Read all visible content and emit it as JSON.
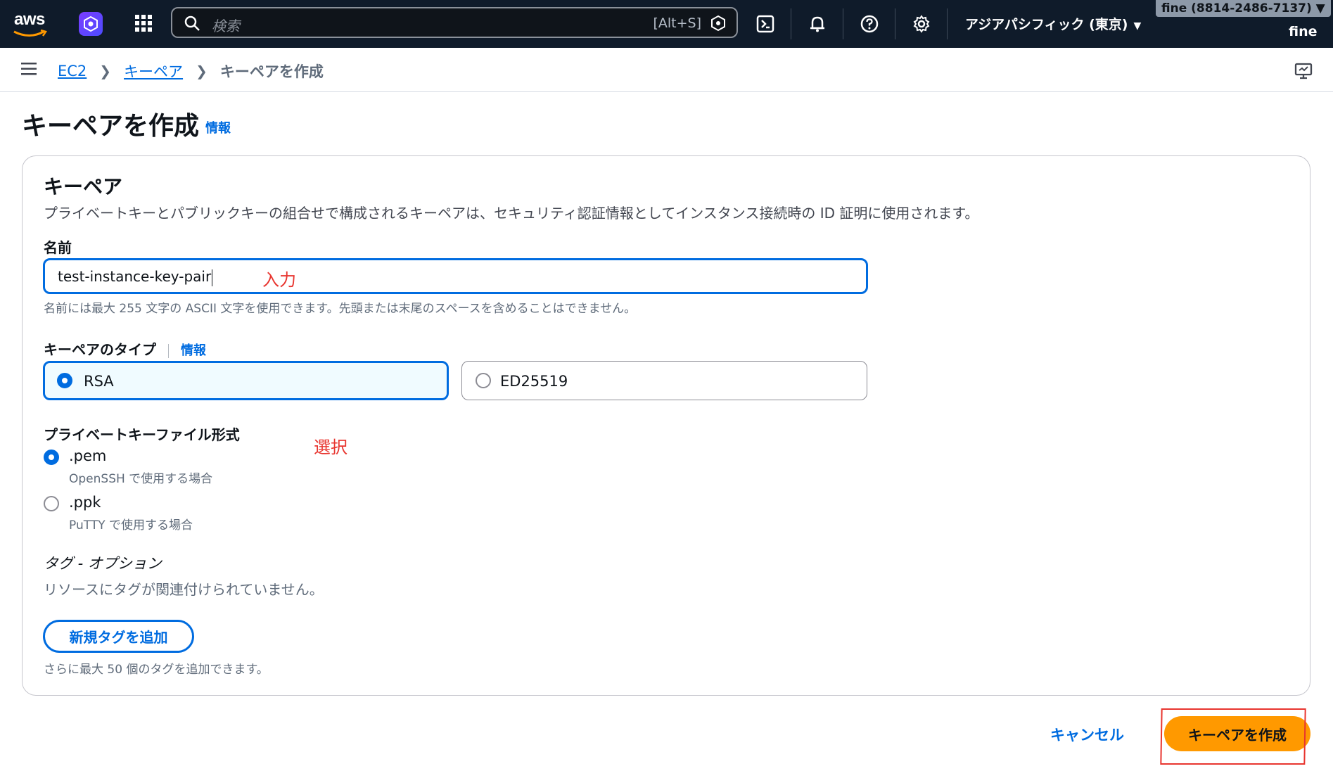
{
  "topnav": {
    "logo_text": "aws",
    "search_placeholder": "検索",
    "search_shortcut": "[Alt+S]",
    "region": "アジアパシフィック (東京)",
    "account_badge": "fine (8814-2486-7137) ▼",
    "account_name": "fine"
  },
  "breadcrumb": {
    "items": [
      "EC2",
      "キーペア"
    ],
    "current": "キーペアを作成"
  },
  "page": {
    "title": "キーペアを作成",
    "info": "情報"
  },
  "panel": {
    "heading": "キーペア",
    "description": "プライベートキーとパブリックキーの組合せで構成されるキーペアは、セキュリティ認証情報としてインスタンス接続時の ID 証明に使用されます。",
    "name": {
      "label": "名前",
      "value": "test-instance-key-pair",
      "hint": "名前には最大 255 文字の ASCII 文字を使用できます。先頭または末尾のスペースを含めることはできません。"
    },
    "key_type": {
      "label": "キーペアのタイプ",
      "info": "情報",
      "options": [
        "RSA",
        "ED25519"
      ],
      "selected": "RSA"
    },
    "file_format": {
      "label": "プライベートキーファイル形式",
      "options": [
        {
          "label": ".pem",
          "sub": "OpenSSH で使用する場合"
        },
        {
          "label": ".ppk",
          "sub": "PuTTY で使用する場合"
        }
      ],
      "selected": ".pem"
    },
    "tags": {
      "heading": "タグ - オプション",
      "empty": "リソースにタグが関連付けられていません。",
      "add_button": "新規タグを追加",
      "limit_hint": "さらに最大 50 個のタグを追加できます。"
    }
  },
  "annotations": {
    "input": "入力",
    "select": "選択"
  },
  "footer": {
    "cancel": "キャンセル",
    "create": "キーペアを作成"
  },
  "colors": {
    "nav_bg": "#0f1b2a",
    "link": "#006ce0",
    "primary": "#ff9900",
    "annotation": "#e8352f"
  }
}
